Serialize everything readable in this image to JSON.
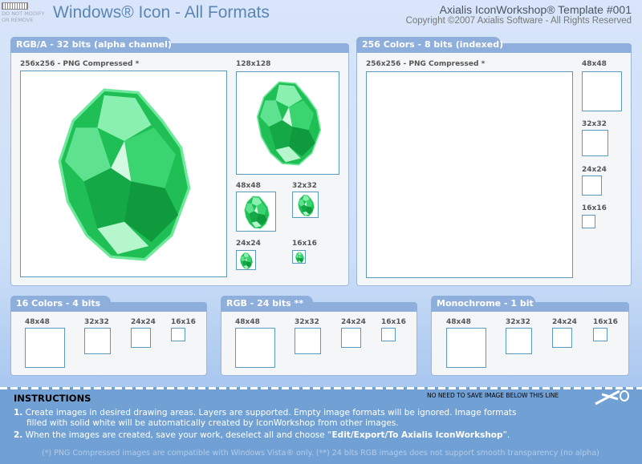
{
  "header": {
    "title": "Windows® Icon - All Formats",
    "brand": "Axialis IconWorkshop® Template #001",
    "copyright": "Copyright ©2007 Axialis Software - All Rights Reserved",
    "badge_line1": "DO NOT MODIFY",
    "badge_line2": "OR REMOVE"
  },
  "panels": {
    "rgba": {
      "title": "RGB/A - 32 bits (alpha channel)",
      "s256": "256x256 - PNG Compressed *",
      "s128": "128x128",
      "s48": "48x48",
      "s32": "32x32",
      "s24": "24x24",
      "s16": "16x16"
    },
    "c256": {
      "title": "256 Colors - 8 bits (indexed)",
      "s256": "256x256 - PNG Compressed *",
      "s48": "48x48",
      "s32": "32x32",
      "s24": "24x24",
      "s16": "16x16"
    },
    "c16": {
      "title": "16 Colors - 4 bits",
      "s48": "48x48",
      "s32": "32x32",
      "s24": "24x24",
      "s16": "16x16"
    },
    "rgb": {
      "title": "RGB - 24 bits **",
      "s48": "48x48",
      "s32": "32x32",
      "s24": "24x24",
      "s16": "16x16"
    },
    "mono": {
      "title": "Monochrome - 1 bit",
      "s48": "48x48",
      "s32": "32x32",
      "s24": "24x24",
      "s16": "16x16"
    }
  },
  "instructions": {
    "heading": "INSTRUCTIONS",
    "no_save": "NO NEED TO SAVE IMAGE BELOW THIS LINE",
    "step1_num": "1.",
    "step1_a": "Create images in desired drawing areas. Layers are supported. Empty image formats will be ignored. Image formats",
    "step1_b": "filled with solid white will be automatically created by IconWorkshop from other images.",
    "step2_num": "2.",
    "step2_a": "When the images are created, save your work, deselect all and choose “",
    "step2_bold": "Edit/Export/To Axialis IconWorkshop",
    "step2_b": "”.",
    "footnote": "(*) PNG Compressed images are compatible with Windows Vista® only.  (**) 24 bits RGB images does not support smooth transparency (no alpha)"
  },
  "colors": {
    "accent": "#8eaedb",
    "band": "#71a1d4",
    "gem": "#2fd46a"
  }
}
